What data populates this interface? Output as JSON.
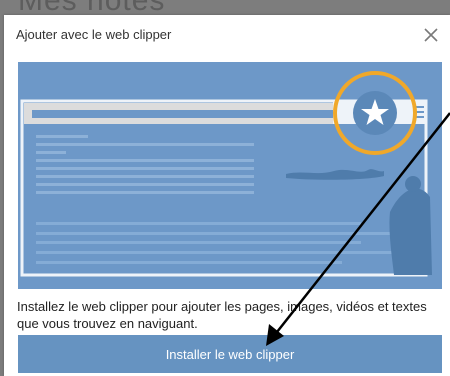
{
  "background": {
    "label": "Mes notes"
  },
  "dialog": {
    "title": "Ajouter avec le web clipper",
    "description": "Installez le web clipper pour ajouter les pages, images, vidéos et textes que vous trouvez en naviguant.",
    "install_label": "Installer le web clipper"
  },
  "icons": {
    "close": "close-icon",
    "star": "star-icon"
  },
  "colors": {
    "illustration_bg": "#6d98c8",
    "highlight_ring": "#f0a82a",
    "button": "#6693c1"
  }
}
